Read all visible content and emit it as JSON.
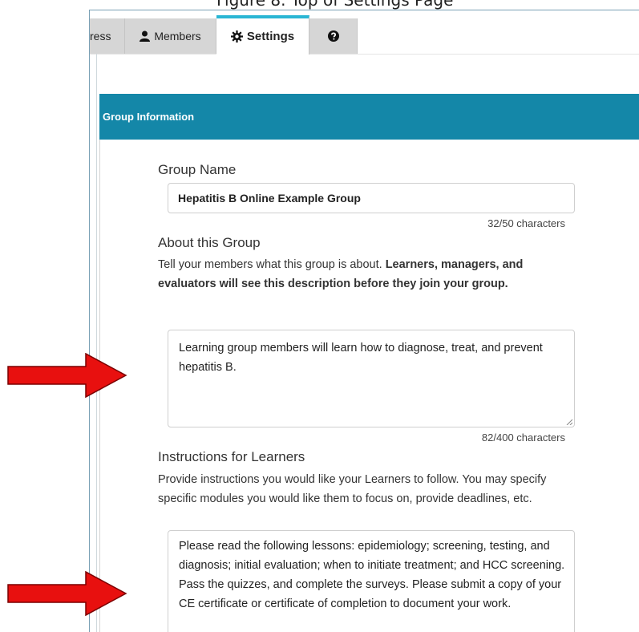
{
  "caption": "Figure 8. Top of Settings Page",
  "tabs": [
    {
      "label": "ress",
      "icon": null
    },
    {
      "label": "Members",
      "icon": "user-icon"
    },
    {
      "label": "Settings",
      "icon": "gear-icon",
      "active": true
    },
    {
      "label": "",
      "icon": "question-circle-icon"
    }
  ],
  "panel": {
    "title": "Group Information"
  },
  "group_name": {
    "label": "Group Name",
    "value": "Hepatitis B Online Example Group",
    "counter": "32/50 characters"
  },
  "about": {
    "label": "About this Group",
    "help_plain": "Tell your members what this group is about. ",
    "help_bold": "Learners, managers, and evaluators will see this description before they join your group.",
    "value": "Learning group members will learn how to diagnose, treat, and prevent hepatitis B.",
    "counter": "82/400 characters"
  },
  "instructions": {
    "label": "Instructions for Learners",
    "help": "Provide instructions you would like your Learners to follow. You may specify specific modules you would like them to focus on, provide deadlines, etc.",
    "value": "Please read the following lessons: epidemiology; screening, testing, and diagnosis; initial evaluation; when to initiate treatment; and HCC screening. Pass the quizzes, and complete the surveys. Please submit a copy of your CE certificate or certificate of completion to document your work."
  },
  "colors": {
    "header": "#1487a8",
    "active_tab_accent": "#29b6d4",
    "arrow": "#e8100f"
  }
}
